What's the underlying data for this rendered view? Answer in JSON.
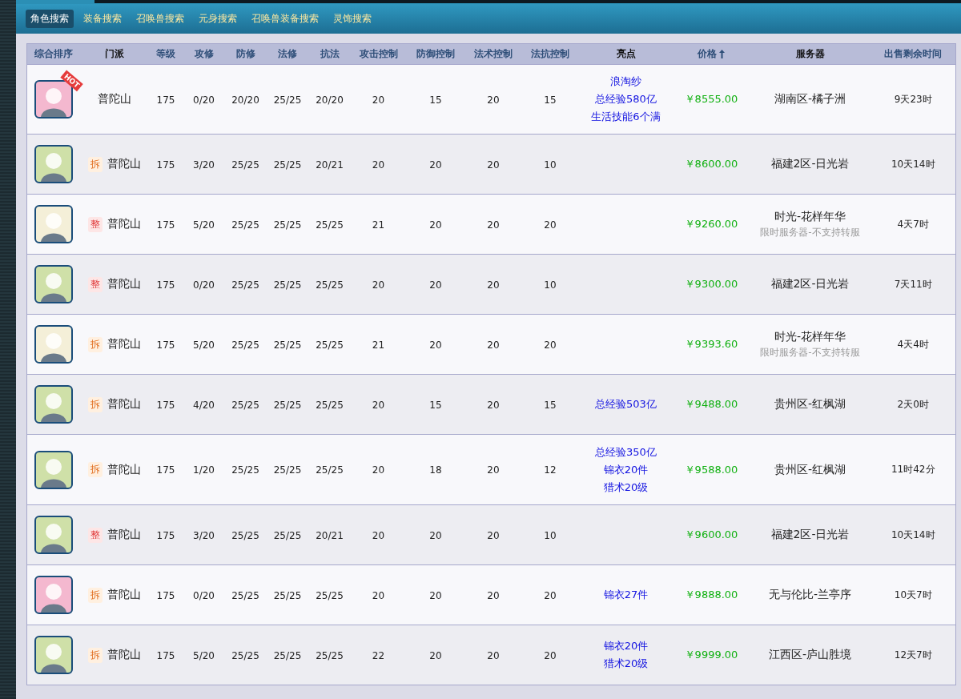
{
  "tabs": [
    {
      "label": "角色搜索",
      "selected": true
    },
    {
      "label": "装备搜索",
      "selected": false
    },
    {
      "label": "召唤兽搜索",
      "selected": false
    },
    {
      "label": "元身搜索",
      "selected": false
    },
    {
      "label": "召唤兽装备搜索",
      "selected": false
    },
    {
      "label": "灵饰搜索",
      "selected": false
    }
  ],
  "table": {
    "columns": [
      {
        "label": "综合排序",
        "sortable": true,
        "sorted": false
      },
      {
        "label": "门派",
        "sortable": false,
        "sorted": false
      },
      {
        "label": "等级",
        "sortable": true,
        "sorted": false
      },
      {
        "label": "攻修",
        "sortable": true,
        "sorted": false
      },
      {
        "label": "防修",
        "sortable": true,
        "sorted": false
      },
      {
        "label": "法修",
        "sortable": true,
        "sorted": false
      },
      {
        "label": "抗法",
        "sortable": true,
        "sorted": false
      },
      {
        "label": "攻击控制",
        "sortable": true,
        "sorted": false
      },
      {
        "label": "防御控制",
        "sortable": true,
        "sorted": false
      },
      {
        "label": "法术控制",
        "sortable": true,
        "sorted": false
      },
      {
        "label": "法抗控制",
        "sortable": true,
        "sorted": false
      },
      {
        "label": "亮点",
        "sortable": false,
        "sorted": false
      },
      {
        "label": "价格",
        "sortable": true,
        "sorted": true
      },
      {
        "label": "服务器",
        "sortable": false,
        "sorted": false
      },
      {
        "label": "出售剩余时间",
        "sortable": true,
        "sorted": false
      }
    ],
    "rows": [
      {
        "avatar": {
          "color": "#f4b8cf",
          "ribbon": "HOT"
        },
        "school": "普陀山",
        "level": "175",
        "atk": "0/20",
        "def": "20/20",
        "mag": "25/25",
        "res": "20/20",
        "c1": "20",
        "c2": "15",
        "c3": "20",
        "c4": "15",
        "highlights": [
          "浪淘纱",
          "总经验580亿",
          "生活技能6个满"
        ],
        "price": "￥8555.00",
        "server": "湖南区-橘子洲",
        "time": "9天23时"
      },
      {
        "avatar": {
          "color": "#cfe0a8"
        },
        "tag": {
          "text": "拆",
          "kind": "split"
        },
        "school": "普陀山",
        "level": "175",
        "atk": "3/20",
        "def": "25/25",
        "mag": "25/25",
        "res": "20/21",
        "c1": "20",
        "c2": "20",
        "c3": "20",
        "c4": "10",
        "price": "￥8600.00",
        "server": "福建2区-日光岩",
        "time": "10天14时"
      },
      {
        "avatar": {
          "color": "#f4efd8"
        },
        "tag": {
          "text": "整",
          "kind": "whole"
        },
        "school": "普陀山",
        "level": "175",
        "atk": "5/20",
        "def": "25/25",
        "mag": "25/25",
        "res": "25/25",
        "c1": "21",
        "c2": "20",
        "c3": "20",
        "c4": "20",
        "price": "￥9260.00",
        "server": "时光-花样年华",
        "server_note": "限时服务器-不支持转服",
        "time": "4天7时"
      },
      {
        "avatar": {
          "color": "#cfe0a8"
        },
        "tag": {
          "text": "整",
          "kind": "whole"
        },
        "school": "普陀山",
        "level": "175",
        "atk": "0/20",
        "def": "25/25",
        "mag": "25/25",
        "res": "25/25",
        "c1": "20",
        "c2": "20",
        "c3": "20",
        "c4": "10",
        "price": "￥9300.00",
        "server": "福建2区-日光岩",
        "time": "7天11时"
      },
      {
        "avatar": {
          "color": "#f4efd8"
        },
        "tag": {
          "text": "拆",
          "kind": "split"
        },
        "school": "普陀山",
        "level": "175",
        "atk": "5/20",
        "def": "25/25",
        "mag": "25/25",
        "res": "25/25",
        "c1": "21",
        "c2": "20",
        "c3": "20",
        "c4": "20",
        "price": "￥9393.60",
        "server": "时光-花样年华",
        "server_note": "限时服务器-不支持转服",
        "time": "4天4时"
      },
      {
        "avatar": {
          "color": "#cfe0a8"
        },
        "tag": {
          "text": "拆",
          "kind": "split"
        },
        "school": "普陀山",
        "level": "175",
        "atk": "4/20",
        "def": "25/25",
        "mag": "25/25",
        "res": "25/25",
        "c1": "20",
        "c2": "15",
        "c3": "20",
        "c4": "15",
        "highlights": [
          "总经验503亿"
        ],
        "price": "￥9488.00",
        "server": "贵州区-红枫湖",
        "time": "2天0时"
      },
      {
        "avatar": {
          "color": "#cfe0a8"
        },
        "tag": {
          "text": "拆",
          "kind": "split"
        },
        "school": "普陀山",
        "level": "175",
        "atk": "1/20",
        "def": "25/25",
        "mag": "25/25",
        "res": "25/25",
        "c1": "20",
        "c2": "18",
        "c3": "20",
        "c4": "12",
        "highlights": [
          "总经验350亿",
          "锦衣20件",
          "猎术20级"
        ],
        "price": "￥9588.00",
        "server": "贵州区-红枫湖",
        "time": "11时42分"
      },
      {
        "avatar": {
          "color": "#cfe0a8"
        },
        "tag": {
          "text": "整",
          "kind": "whole"
        },
        "school": "普陀山",
        "level": "175",
        "atk": "3/20",
        "def": "25/25",
        "mag": "25/25",
        "res": "20/21",
        "c1": "20",
        "c2": "20",
        "c3": "20",
        "c4": "10",
        "price": "￥9600.00",
        "server": "福建2区-日光岩",
        "time": "10天14时"
      },
      {
        "avatar": {
          "color": "#f4b8cf"
        },
        "tag": {
          "text": "拆",
          "kind": "split"
        },
        "school": "普陀山",
        "level": "175",
        "atk": "0/20",
        "def": "25/25",
        "mag": "25/25",
        "res": "25/25",
        "c1": "20",
        "c2": "20",
        "c3": "20",
        "c4": "20",
        "highlights": [
          "锦衣27件"
        ],
        "price": "￥9888.00",
        "server": "无与伦比-兰亭序",
        "time": "10天7时"
      },
      {
        "avatar": {
          "color": "#cfe0a8"
        },
        "tag": {
          "text": "拆",
          "kind": "split"
        },
        "school": "普陀山",
        "level": "175",
        "atk": "5/20",
        "def": "25/25",
        "mag": "25/25",
        "res": "25/25",
        "c1": "22",
        "c2": "20",
        "c3": "20",
        "c4": "20",
        "highlights": [
          "锦衣20件",
          "猎术20级"
        ],
        "price": "￥9999.00",
        "server": "江西区-庐山胜境",
        "time": "12天7时"
      }
    ]
  }
}
